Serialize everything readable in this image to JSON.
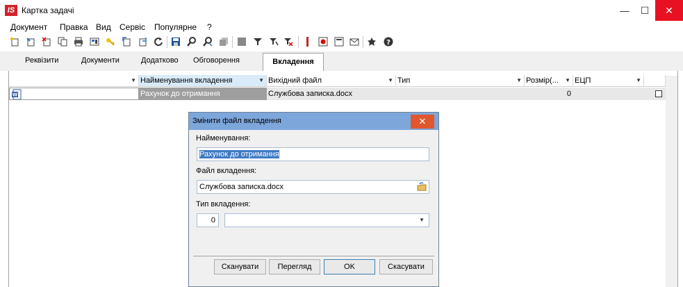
{
  "window": {
    "title": "Картка задачі",
    "app_badge": "IS"
  },
  "menu": [
    "Документ",
    "Правка",
    "Вид",
    "Сервіс",
    "Популярне",
    "?"
  ],
  "tabs": [
    {
      "label": "Реквізити"
    },
    {
      "label": "Документи"
    },
    {
      "label": "Додатково"
    },
    {
      "label": "Обговорення"
    },
    {
      "label": "Вкладення",
      "active": true
    }
  ],
  "grid": {
    "columns": [
      "Найменування вкладення",
      "Вихідний файл",
      "Тип",
      "Розмір(...",
      "ЕЦП"
    ],
    "rows": [
      {
        "name": "Рахунок до отримання",
        "file": "Службова записка.docx",
        "type": "",
        "size": "0",
        "signed": false
      }
    ]
  },
  "dialog": {
    "title": "Змінити файл вкладення",
    "name_label": "Найменування:",
    "name_value": "Рахунок до отримання",
    "file_label": "Файл вкладення:",
    "file_value": "Службова записка.docx",
    "type_label": "Тип вкладення:",
    "type_code": "0",
    "type_value": "",
    "buttons": {
      "scan": "Сканувати",
      "view": "Перегляд",
      "ok": "OK",
      "cancel": "Скасувати"
    }
  },
  "colors": {
    "accent": "#7da6db",
    "selection": "#3f7ac5",
    "close": "#e81123"
  }
}
